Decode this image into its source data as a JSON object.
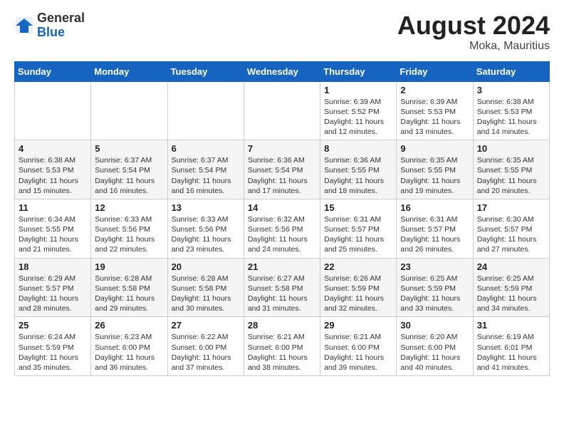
{
  "logo": {
    "general": "General",
    "blue": "Blue"
  },
  "title": "August 2024",
  "location": "Moka, Mauritius",
  "days_of_week": [
    "Sunday",
    "Monday",
    "Tuesday",
    "Wednesday",
    "Thursday",
    "Friday",
    "Saturday"
  ],
  "weeks": [
    [
      {
        "day": "",
        "info": ""
      },
      {
        "day": "",
        "info": ""
      },
      {
        "day": "",
        "info": ""
      },
      {
        "day": "",
        "info": ""
      },
      {
        "day": "1",
        "info": "Sunrise: 6:39 AM\nSunset: 5:52 PM\nDaylight: 11 hours\nand 12 minutes."
      },
      {
        "day": "2",
        "info": "Sunrise: 6:39 AM\nSunset: 5:53 PM\nDaylight: 11 hours\nand 13 minutes."
      },
      {
        "day": "3",
        "info": "Sunrise: 6:38 AM\nSunset: 5:53 PM\nDaylight: 11 hours\nand 14 minutes."
      }
    ],
    [
      {
        "day": "4",
        "info": "Sunrise: 6:38 AM\nSunset: 5:53 PM\nDaylight: 11 hours\nand 15 minutes."
      },
      {
        "day": "5",
        "info": "Sunrise: 6:37 AM\nSunset: 5:54 PM\nDaylight: 11 hours\nand 16 minutes."
      },
      {
        "day": "6",
        "info": "Sunrise: 6:37 AM\nSunset: 5:54 PM\nDaylight: 11 hours\nand 16 minutes."
      },
      {
        "day": "7",
        "info": "Sunrise: 6:36 AM\nSunset: 5:54 PM\nDaylight: 11 hours\nand 17 minutes."
      },
      {
        "day": "8",
        "info": "Sunrise: 6:36 AM\nSunset: 5:55 PM\nDaylight: 11 hours\nand 18 minutes."
      },
      {
        "day": "9",
        "info": "Sunrise: 6:35 AM\nSunset: 5:55 PM\nDaylight: 11 hours\nand 19 minutes."
      },
      {
        "day": "10",
        "info": "Sunrise: 6:35 AM\nSunset: 5:55 PM\nDaylight: 11 hours\nand 20 minutes."
      }
    ],
    [
      {
        "day": "11",
        "info": "Sunrise: 6:34 AM\nSunset: 5:55 PM\nDaylight: 11 hours\nand 21 minutes."
      },
      {
        "day": "12",
        "info": "Sunrise: 6:33 AM\nSunset: 5:56 PM\nDaylight: 11 hours\nand 22 minutes."
      },
      {
        "day": "13",
        "info": "Sunrise: 6:33 AM\nSunset: 5:56 PM\nDaylight: 11 hours\nand 23 minutes."
      },
      {
        "day": "14",
        "info": "Sunrise: 6:32 AM\nSunset: 5:56 PM\nDaylight: 11 hours\nand 24 minutes."
      },
      {
        "day": "15",
        "info": "Sunrise: 6:31 AM\nSunset: 5:57 PM\nDaylight: 11 hours\nand 25 minutes."
      },
      {
        "day": "16",
        "info": "Sunrise: 6:31 AM\nSunset: 5:57 PM\nDaylight: 11 hours\nand 26 minutes."
      },
      {
        "day": "17",
        "info": "Sunrise: 6:30 AM\nSunset: 5:57 PM\nDaylight: 11 hours\nand 27 minutes."
      }
    ],
    [
      {
        "day": "18",
        "info": "Sunrise: 6:29 AM\nSunset: 5:57 PM\nDaylight: 11 hours\nand 28 minutes."
      },
      {
        "day": "19",
        "info": "Sunrise: 6:28 AM\nSunset: 5:58 PM\nDaylight: 11 hours\nand 29 minutes."
      },
      {
        "day": "20",
        "info": "Sunrise: 6:28 AM\nSunset: 5:58 PM\nDaylight: 11 hours\nand 30 minutes."
      },
      {
        "day": "21",
        "info": "Sunrise: 6:27 AM\nSunset: 5:58 PM\nDaylight: 11 hours\nand 31 minutes."
      },
      {
        "day": "22",
        "info": "Sunrise: 6:26 AM\nSunset: 5:59 PM\nDaylight: 11 hours\nand 32 minutes."
      },
      {
        "day": "23",
        "info": "Sunrise: 6:25 AM\nSunset: 5:59 PM\nDaylight: 11 hours\nand 33 minutes."
      },
      {
        "day": "24",
        "info": "Sunrise: 6:25 AM\nSunset: 5:59 PM\nDaylight: 11 hours\nand 34 minutes."
      }
    ],
    [
      {
        "day": "25",
        "info": "Sunrise: 6:24 AM\nSunset: 5:59 PM\nDaylight: 11 hours\nand 35 minutes."
      },
      {
        "day": "26",
        "info": "Sunrise: 6:23 AM\nSunset: 6:00 PM\nDaylight: 11 hours\nand 36 minutes."
      },
      {
        "day": "27",
        "info": "Sunrise: 6:22 AM\nSunset: 6:00 PM\nDaylight: 11 hours\nand 37 minutes."
      },
      {
        "day": "28",
        "info": "Sunrise: 6:21 AM\nSunset: 6:00 PM\nDaylight: 11 hours\nand 38 minutes."
      },
      {
        "day": "29",
        "info": "Sunrise: 6:21 AM\nSunset: 6:00 PM\nDaylight: 11 hours\nand 39 minutes."
      },
      {
        "day": "30",
        "info": "Sunrise: 6:20 AM\nSunset: 6:00 PM\nDaylight: 11 hours\nand 40 minutes."
      },
      {
        "day": "31",
        "info": "Sunrise: 6:19 AM\nSunset: 6:01 PM\nDaylight: 11 hours\nand 41 minutes."
      }
    ]
  ]
}
